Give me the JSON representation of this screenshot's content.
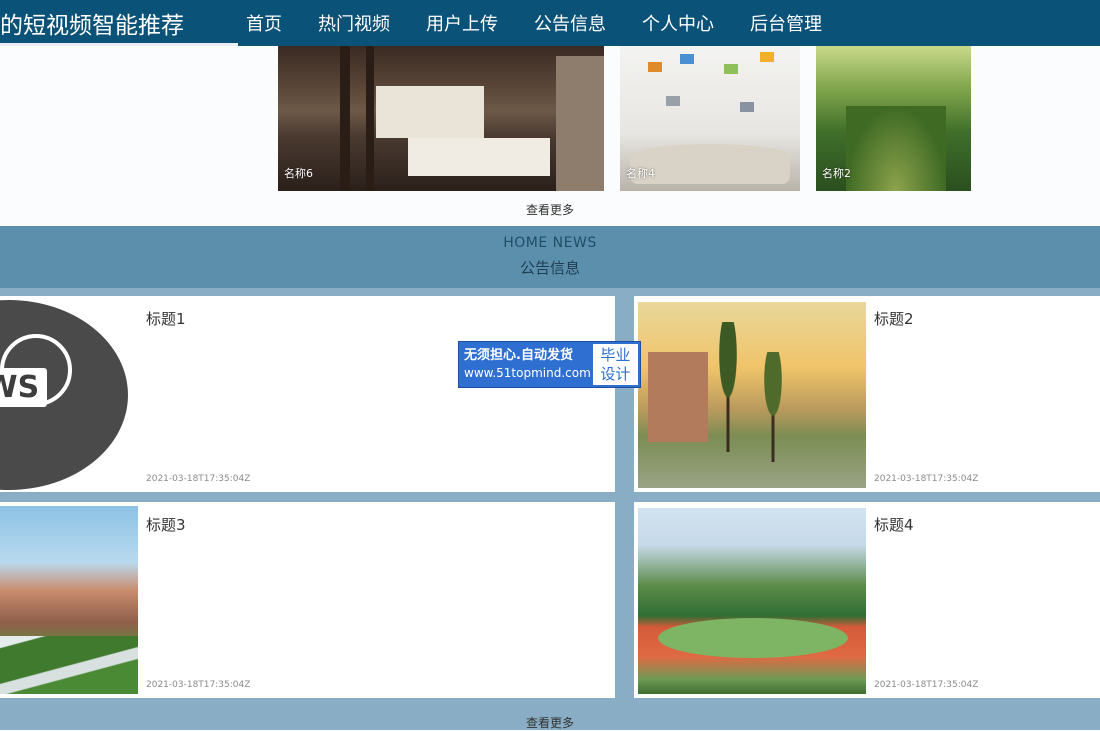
{
  "header": {
    "brand": "的短视频智能推荐",
    "menu": [
      "首页",
      "热门视频",
      "用户上传",
      "公告信息",
      "个人中心",
      "后台管理"
    ]
  },
  "videos": {
    "items": [
      {
        "label": "名称6"
      },
      {
        "label": "名称4"
      },
      {
        "label": "名称2"
      }
    ],
    "more_label": "查看更多"
  },
  "news": {
    "heading_en": "HOME NEWS",
    "heading_cn": "公告信息",
    "items": [
      {
        "title": "标题1",
        "date": "2021-03-18T17:35:04Z"
      },
      {
        "title": "标题2",
        "date": "2021-03-18T17:35:04Z"
      },
      {
        "title": "标题3",
        "date": "2021-03-18T17:35:04Z"
      },
      {
        "title": "标题4",
        "date": "2021-03-18T17:35:04Z"
      }
    ],
    "more_label": "查看更多",
    "thumb_badge": "EWS"
  },
  "ad": {
    "line1": "无须担心.自动发货",
    "line2": "www.51topmind.com",
    "tag1": "毕业",
    "tag2": "设计"
  },
  "colors": {
    "nav_bg": "#0b5278",
    "news_bg": "#88adc4",
    "news_head_bg": "#5c8fab",
    "ad_bg": "#2f6fd1"
  }
}
